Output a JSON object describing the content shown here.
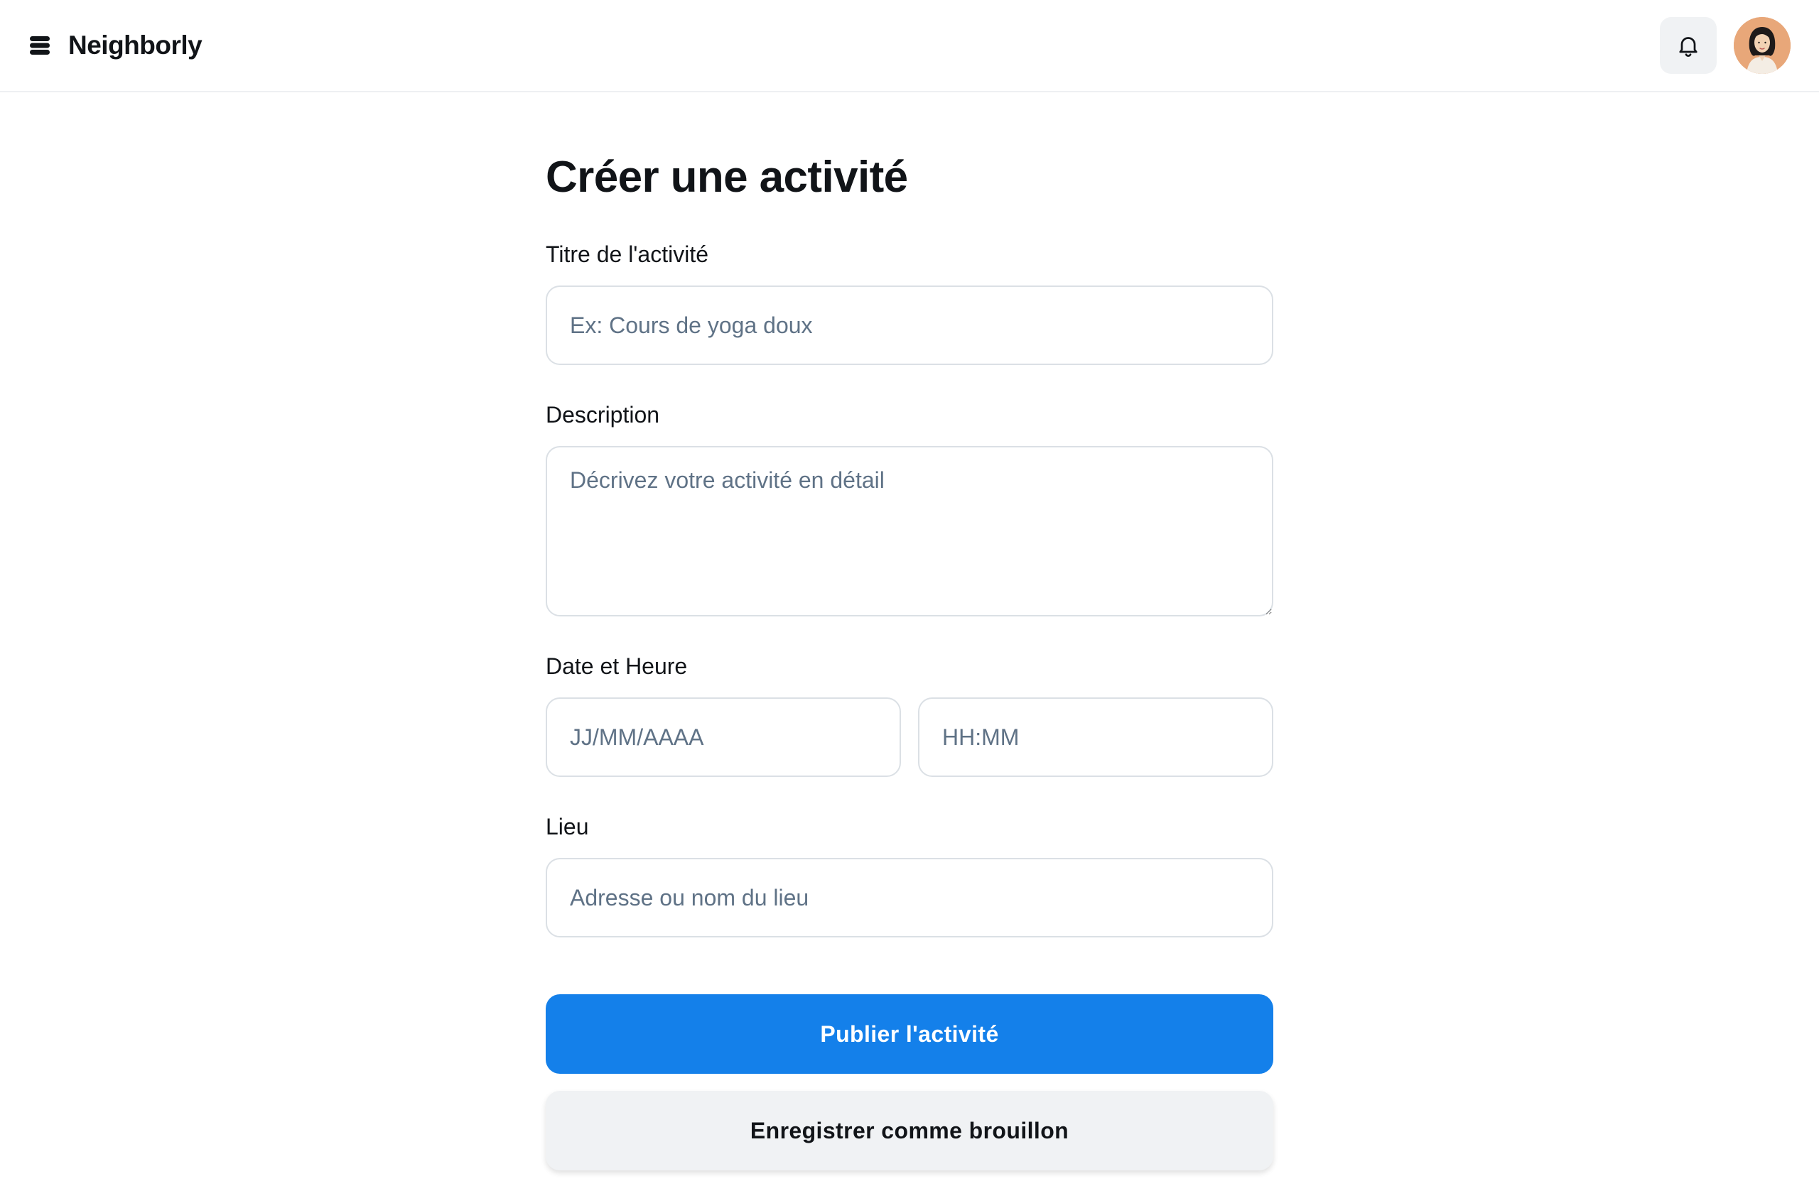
{
  "header": {
    "brand_name": "Neighborly",
    "logo_icon": "stack-logo-icon",
    "notification_icon": "bell-icon",
    "avatar_icon": "user-avatar"
  },
  "form": {
    "title": "Créer une activité",
    "title_field": {
      "label": "Titre de l'activité",
      "placeholder": "Ex: Cours de yoga doux",
      "value": ""
    },
    "description_field": {
      "label": "Description",
      "placeholder": "Décrivez votre activité en détail",
      "value": ""
    },
    "datetime_field": {
      "label": "Date et Heure",
      "date_placeholder": "JJ/MM/AAAA",
      "time_placeholder": "HH:MM"
    },
    "location_field": {
      "label": "Lieu",
      "placeholder": "Adresse ou nom du lieu",
      "value": ""
    },
    "publish_label": "Publier l'activité",
    "draft_label": "Enregistrer comme brouillon"
  },
  "colors": {
    "primary": "#1480ea",
    "secondary_bg": "#f0f2f4",
    "border": "#dbe0e5",
    "placeholder": "#5f7286",
    "text": "#111418"
  }
}
